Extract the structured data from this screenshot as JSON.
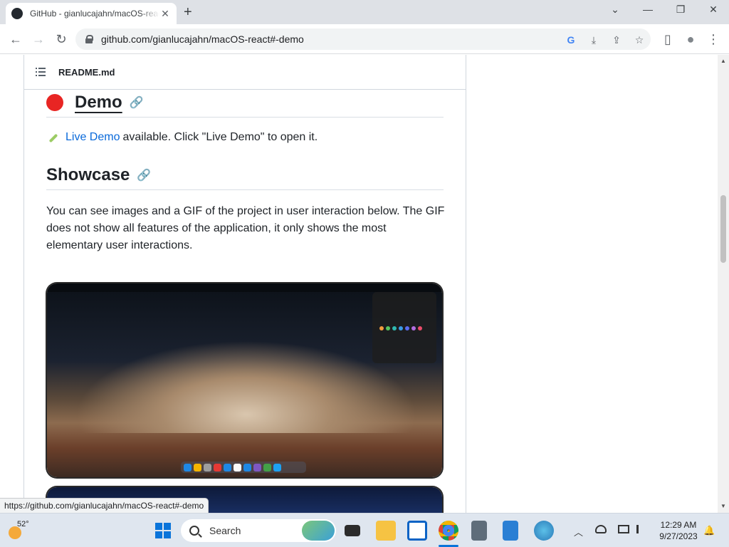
{
  "browser": {
    "tab_title": "GitHub - gianlucajahn/macOS-react#-demo",
    "tab_close": "✕",
    "new_tab": "+",
    "url": "github.com/gianlucajahn/macOS-react#-demo",
    "window_controls": {
      "tabsearch": "⌄",
      "minimize": "—",
      "restore": "❐",
      "close": "✕"
    },
    "nav": {
      "back": "←",
      "forward": "→",
      "reload": "↻"
    },
    "omnibox_icons": {
      "google": "G",
      "install": "⤓",
      "share": "⇪",
      "bookmark": "☆"
    },
    "side_icons": {
      "sidepanel": "▯",
      "profile": "●",
      "menu": "⋮"
    },
    "status_url": "https://github.com/gianlucajahn/macOS-react#-demo"
  },
  "readme": {
    "filename": "README.md",
    "demo_heading": "Demo",
    "live_demo_link": "Live Demo",
    "live_demo_text": "available. Click \"Live Demo\" to open it.",
    "showcase_heading": "Showcase",
    "showcase_paragraph": "You can see images and a GIF of the project in user interaction below. The GIF does not show all features of the application, it only shows the most elementary user interactions.",
    "anchor_glyph": "🔗"
  },
  "colors": {
    "demo_dot": "#e82523",
    "link": "#0969da",
    "swatches": [
      "#f39c3d",
      "#57c35f",
      "#2fb8b0",
      "#3a9ae6",
      "#5b6cf0",
      "#b26de0",
      "#ea4c6b"
    ],
    "dock_icons": [
      "#1e88e5",
      "#f4b400",
      "#9e9e9e",
      "#e53935",
      "#1e88e5",
      "#fafafa",
      "#1e88e5",
      "#7e57c2",
      "#43a047",
      "#1da1f2"
    ]
  },
  "taskbar": {
    "temperature": "52°",
    "search_placeholder": "Search",
    "time": "12:29 AM",
    "date": "9/27/2023",
    "tray": {
      "chevron": "︿",
      "notifications": "🔔"
    }
  }
}
